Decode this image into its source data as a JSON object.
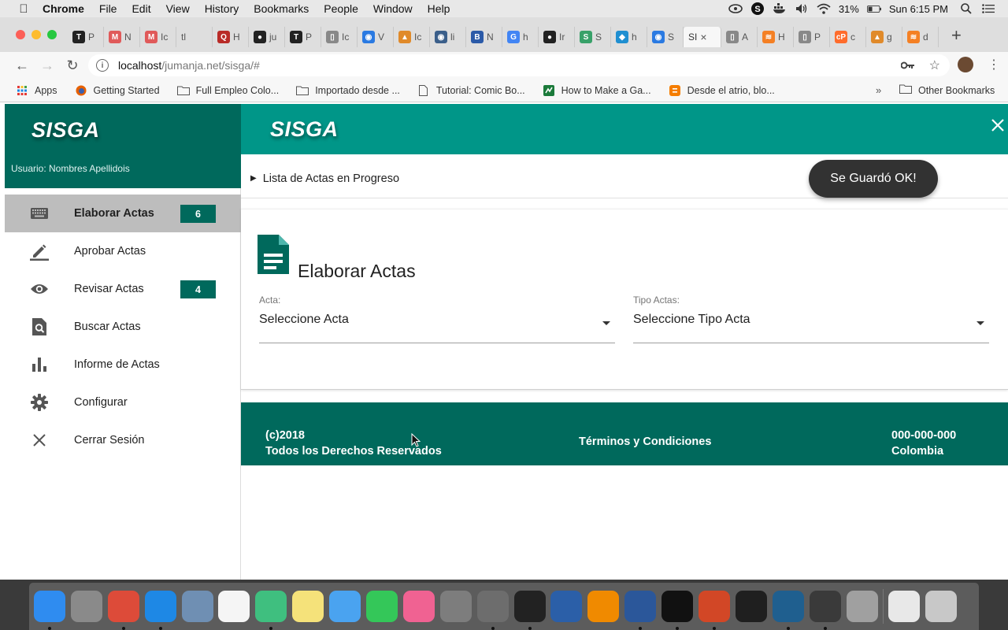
{
  "menubar": {
    "app": "Chrome",
    "menus": [
      "File",
      "Edit",
      "View",
      "History",
      "Bookmarks",
      "People",
      "Window",
      "Help"
    ],
    "battery": "31%",
    "clock": "Sun 6:15 PM"
  },
  "tabs": [
    {
      "title": "P",
      "icon": "T",
      "color": "#222222"
    },
    {
      "title": "N",
      "icon": "M",
      "color": "#e05a5a"
    },
    {
      "title": "Ic",
      "icon": "M",
      "color": "#e05a5a"
    },
    {
      "title": "tl",
      "icon": "",
      "color": "#dedede"
    },
    {
      "title": "H",
      "icon": "Q",
      "color": "#b92b27"
    },
    {
      "title": "ju",
      "icon": "●",
      "color": "#222222"
    },
    {
      "title": "P",
      "icon": "T",
      "color": "#222222"
    },
    {
      "title": "Ic",
      "icon": "▯",
      "color": "#888888"
    },
    {
      "title": "V",
      "icon": "◉",
      "color": "#2a7ae2"
    },
    {
      "title": "Ic",
      "icon": "▲",
      "color": "#e08a2a"
    },
    {
      "title": "li",
      "icon": "◉",
      "color": "#3b5f8a"
    },
    {
      "title": "N",
      "icon": "B",
      "color": "#2b5aa8"
    },
    {
      "title": "h",
      "icon": "G",
      "color": "#4285f4"
    },
    {
      "title": "Ir",
      "icon": "●",
      "color": "#222222"
    },
    {
      "title": "S",
      "icon": "S",
      "color": "#38a169"
    },
    {
      "title": "h",
      "icon": "◆",
      "color": "#1f8fd1"
    },
    {
      "title": "S",
      "icon": "◉",
      "color": "#2a7ae2"
    },
    {
      "title": "SI",
      "icon": "",
      "color": "#f7f7f7",
      "active": true
    },
    {
      "title": "A",
      "icon": "▯",
      "color": "#888888"
    },
    {
      "title": "H",
      "icon": "≋",
      "color": "#f48024"
    },
    {
      "title": "P",
      "icon": "▯",
      "color": "#888888"
    },
    {
      "title": "c",
      "icon": "cP",
      "color": "#ff6c2c"
    },
    {
      "title": "g",
      "icon": "▲",
      "color": "#e08a2a"
    },
    {
      "title": "d",
      "icon": "≋",
      "color": "#f48024"
    }
  ],
  "address": {
    "host": "localhost",
    "path": "/jumanja.net/sisga/#"
  },
  "bookmarks": [
    {
      "label": "Apps",
      "icon": "apps"
    },
    {
      "label": "Getting Started",
      "icon": "firefox"
    },
    {
      "label": "Full Empleo Colo...",
      "icon": "folder"
    },
    {
      "label": "Importado desde ...",
      "icon": "folder"
    },
    {
      "label": "Tutorial: Comic Bo...",
      "icon": "page"
    },
    {
      "label": "How to Make a Ga...",
      "icon": "green"
    },
    {
      "label": "Desde el atrio, blo...",
      "icon": "blogger"
    }
  ],
  "bookmarks_other": "Other Bookmarks",
  "sidebar": {
    "brand": "SISGA",
    "user": "Usuario: Nombres Apellidois",
    "items": [
      {
        "label": "Elaborar Actas",
        "icon": "keyboard-icon",
        "badge": "6",
        "active": true
      },
      {
        "label": "Aprobar Actas",
        "icon": "pencil-icon",
        "badge": ""
      },
      {
        "label": "Revisar Actas",
        "icon": "eye-icon",
        "badge": "4"
      },
      {
        "label": "Buscar Actas",
        "icon": "search-document-icon",
        "badge": ""
      },
      {
        "label": "Informe de Actas",
        "icon": "bar-chart-icon",
        "badge": ""
      },
      {
        "label": "Configurar",
        "icon": "gear-icon",
        "badge": ""
      },
      {
        "label": "Cerrar Sesión",
        "icon": "close-icon",
        "badge": ""
      }
    ]
  },
  "topbar": {
    "brand": "SISGA"
  },
  "progress": {
    "label": "Lista de Actas en Progreso"
  },
  "toast": "Se Guardó OK!",
  "card": {
    "title": "Elaborar Actas",
    "acta_label": "Acta:",
    "acta_value": "Seleccione Acta",
    "tipo_label": "Tipo Actas:",
    "tipo_value": "Seleccione Tipo Acta"
  },
  "footer": {
    "copyright": "(c)2018",
    "rights": "Todos los Derechos Reservados",
    "terms": "Términos y Condiciones",
    "phone": "000-000-000",
    "country": "Colombia"
  },
  "dock": [
    {
      "name": "finder",
      "color": "#2f8cf0",
      "running": true
    },
    {
      "name": "launchpad",
      "color": "#8a8a8a",
      "running": false
    },
    {
      "name": "chrome",
      "color": "#dd4b39",
      "running": true
    },
    {
      "name": "safari",
      "color": "#1e88e5",
      "running": true
    },
    {
      "name": "preview-eagle",
      "color": "#6f8fb3",
      "running": false
    },
    {
      "name": "calendar",
      "color": "#f5f5f5",
      "running": false
    },
    {
      "name": "atom",
      "color": "#3fbf7f",
      "running": true
    },
    {
      "name": "notes",
      "color": "#f5e27a",
      "running": false
    },
    {
      "name": "messages",
      "color": "#4aa3f0",
      "running": false
    },
    {
      "name": "facetime",
      "color": "#34c759",
      "running": false
    },
    {
      "name": "itunes",
      "color": "#f06292",
      "running": false
    },
    {
      "name": "system-preferences",
      "color": "#7d7d7d",
      "running": false
    },
    {
      "name": "gimp",
      "color": "#6d6d6d",
      "running": true
    },
    {
      "name": "inkscape",
      "color": "#222222",
      "running": true
    },
    {
      "name": "sourcetree",
      "color": "#2b5fa8",
      "running": false
    },
    {
      "name": "vlc",
      "color": "#f08a00",
      "running": false
    },
    {
      "name": "word",
      "color": "#2b579a",
      "running": true
    },
    {
      "name": "terminal",
      "color": "#111111",
      "running": true
    },
    {
      "name": "powerpoint",
      "color": "#d24726",
      "running": true
    },
    {
      "name": "activity-monitor",
      "color": "#1f1f1f",
      "running": false
    },
    {
      "name": "mysql-workbench",
      "color": "#1f5f8f",
      "running": true
    },
    {
      "name": "xquartz",
      "color": "#3a3a3a",
      "running": true
    },
    {
      "name": "photos",
      "color": "#a0a0a0",
      "running": false
    },
    {
      "name": "document",
      "color": "#e8e8e8",
      "running": false
    },
    {
      "name": "trash",
      "color": "#c8c8c8",
      "running": false
    }
  ]
}
